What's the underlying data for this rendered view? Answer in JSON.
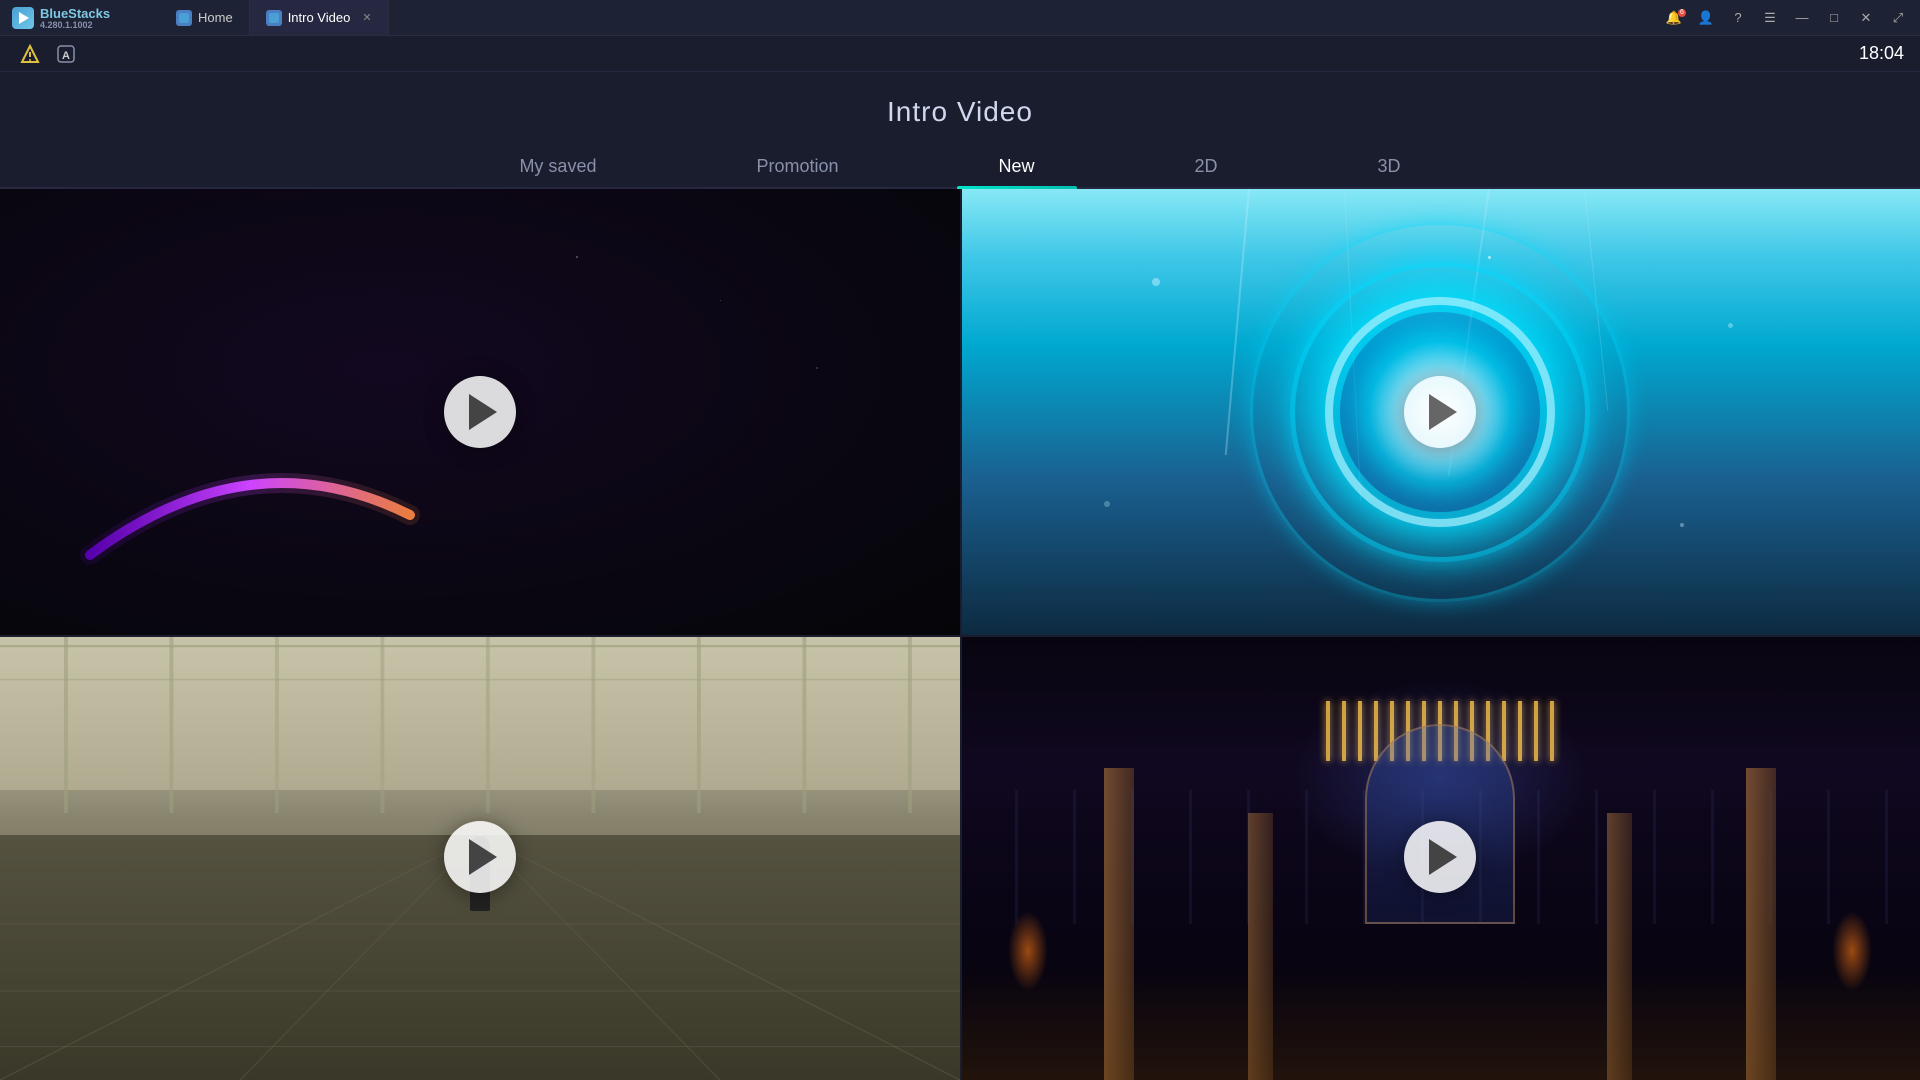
{
  "app": {
    "name": "BlueStacks",
    "version": "4.280.1.1002",
    "time": "18:04"
  },
  "titlebar": {
    "tabs": [
      {
        "id": "home",
        "label": "Home",
        "active": false
      },
      {
        "id": "intro-video",
        "label": "Intro Video",
        "active": true
      }
    ],
    "buttons": {
      "minimize": "—",
      "maximize": "□",
      "close": "✕",
      "expand": "⤢"
    }
  },
  "topbar": {
    "icon1": "⚠",
    "icon2": "A"
  },
  "page": {
    "title": "Intro Video",
    "tabs": [
      {
        "id": "my-saved",
        "label": "My saved",
        "active": false
      },
      {
        "id": "promotion",
        "label": "Promotion",
        "active": false
      },
      {
        "id": "new",
        "label": "New",
        "active": true
      },
      {
        "id": "2d",
        "label": "2D",
        "active": false
      },
      {
        "id": "3d",
        "label": "3D",
        "active": false
      }
    ]
  },
  "videos": [
    {
      "id": 1,
      "title": "Purple Arc",
      "play_label": "▶"
    },
    {
      "id": 2,
      "title": "Cyan Portal",
      "play_label": "▶"
    },
    {
      "id": 3,
      "title": "Stadium",
      "play_label": "▶"
    },
    {
      "id": 4,
      "title": "Fantasy Hall",
      "play_label": "▶"
    }
  ]
}
